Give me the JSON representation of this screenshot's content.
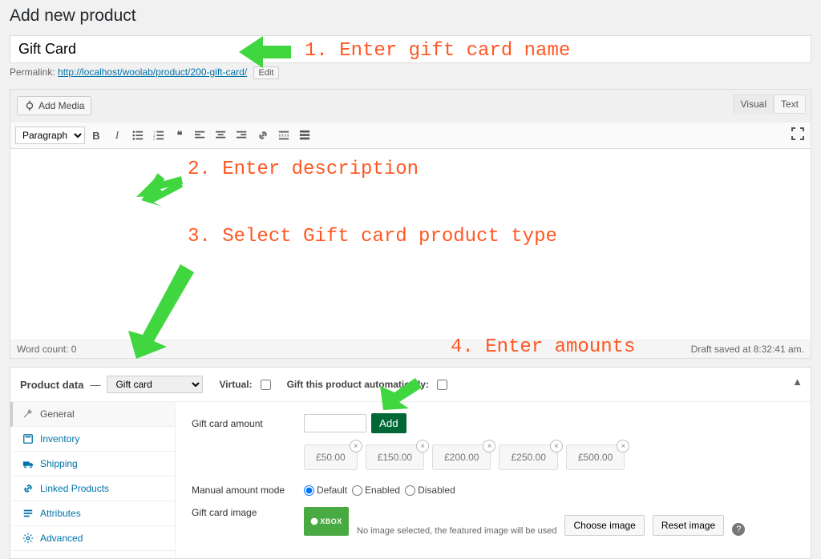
{
  "header": {
    "title": "Add new product"
  },
  "title_field": {
    "value": "Gift Card"
  },
  "permalink": {
    "label": "Permalink:",
    "url": "http://localhost/woolab/product/200-gift-card/",
    "edit_label": "Edit"
  },
  "media": {
    "add_media_label": "Add Media"
  },
  "editor_tabs": {
    "visual": "Visual",
    "text": "Text"
  },
  "toolbar": {
    "format_select": "Paragraph"
  },
  "editor_status": {
    "word_count_label": "Word count: 0",
    "draft_saved": "Draft saved at 8:32:41 am."
  },
  "product_data": {
    "title": "Product data",
    "select_value": "Gift card",
    "virtual_label": "Virtual:",
    "gift_auto_label": "Gift this product automatically:",
    "tabs": [
      {
        "key": "general",
        "label": "General"
      },
      {
        "key": "inventory",
        "label": "Inventory"
      },
      {
        "key": "shipping",
        "label": "Shipping"
      },
      {
        "key": "linked",
        "label": "Linked Products"
      },
      {
        "key": "attributes",
        "label": "Attributes"
      },
      {
        "key": "advanced",
        "label": "Advanced"
      }
    ],
    "fields": {
      "amount_label": "Gift card amount",
      "add_button": "Add",
      "amounts": [
        "£50.00",
        "£150.00",
        "£200.00",
        "£250.00",
        "£500.00"
      ],
      "manual_mode_label": "Manual amount mode",
      "manual_options": [
        "Default",
        "Enabled",
        "Disabled"
      ],
      "image_label": "Gift card image",
      "image_thumb_text": "XBOX",
      "image_hint": "No image selected, the featured image will be used",
      "choose_image": "Choose image",
      "reset_image": "Reset image"
    }
  },
  "annotations": {
    "a1": "1. Enter gift card name",
    "a2": "2. Enter description",
    "a3": "3. Select Gift card product type",
    "a4": "4. Enter amounts"
  }
}
